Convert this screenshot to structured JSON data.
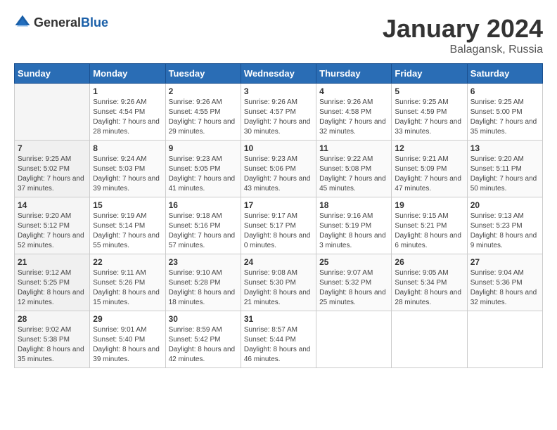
{
  "header": {
    "logo_general": "General",
    "logo_blue": "Blue",
    "month_title": "January 2024",
    "location": "Balagansk, Russia"
  },
  "weekdays": [
    "Sunday",
    "Monday",
    "Tuesday",
    "Wednesday",
    "Thursday",
    "Friday",
    "Saturday"
  ],
  "weeks": [
    [
      {
        "day": "",
        "sunrise": "",
        "sunset": "",
        "daylight": ""
      },
      {
        "day": "1",
        "sunrise": "Sunrise: 9:26 AM",
        "sunset": "Sunset: 4:54 PM",
        "daylight": "Daylight: 7 hours and 28 minutes."
      },
      {
        "day": "2",
        "sunrise": "Sunrise: 9:26 AM",
        "sunset": "Sunset: 4:55 PM",
        "daylight": "Daylight: 7 hours and 29 minutes."
      },
      {
        "day": "3",
        "sunrise": "Sunrise: 9:26 AM",
        "sunset": "Sunset: 4:57 PM",
        "daylight": "Daylight: 7 hours and 30 minutes."
      },
      {
        "day": "4",
        "sunrise": "Sunrise: 9:26 AM",
        "sunset": "Sunset: 4:58 PM",
        "daylight": "Daylight: 7 hours and 32 minutes."
      },
      {
        "day": "5",
        "sunrise": "Sunrise: 9:25 AM",
        "sunset": "Sunset: 4:59 PM",
        "daylight": "Daylight: 7 hours and 33 minutes."
      },
      {
        "day": "6",
        "sunrise": "Sunrise: 9:25 AM",
        "sunset": "Sunset: 5:00 PM",
        "daylight": "Daylight: 7 hours and 35 minutes."
      }
    ],
    [
      {
        "day": "7",
        "sunrise": "Sunrise: 9:25 AM",
        "sunset": "Sunset: 5:02 PM",
        "daylight": "Daylight: 7 hours and 37 minutes."
      },
      {
        "day": "8",
        "sunrise": "Sunrise: 9:24 AM",
        "sunset": "Sunset: 5:03 PM",
        "daylight": "Daylight: 7 hours and 39 minutes."
      },
      {
        "day": "9",
        "sunrise": "Sunrise: 9:23 AM",
        "sunset": "Sunset: 5:05 PM",
        "daylight": "Daylight: 7 hours and 41 minutes."
      },
      {
        "day": "10",
        "sunrise": "Sunrise: 9:23 AM",
        "sunset": "Sunset: 5:06 PM",
        "daylight": "Daylight: 7 hours and 43 minutes."
      },
      {
        "day": "11",
        "sunrise": "Sunrise: 9:22 AM",
        "sunset": "Sunset: 5:08 PM",
        "daylight": "Daylight: 7 hours and 45 minutes."
      },
      {
        "day": "12",
        "sunrise": "Sunrise: 9:21 AM",
        "sunset": "Sunset: 5:09 PM",
        "daylight": "Daylight: 7 hours and 47 minutes."
      },
      {
        "day": "13",
        "sunrise": "Sunrise: 9:20 AM",
        "sunset": "Sunset: 5:11 PM",
        "daylight": "Daylight: 7 hours and 50 minutes."
      }
    ],
    [
      {
        "day": "14",
        "sunrise": "Sunrise: 9:20 AM",
        "sunset": "Sunset: 5:12 PM",
        "daylight": "Daylight: 7 hours and 52 minutes."
      },
      {
        "day": "15",
        "sunrise": "Sunrise: 9:19 AM",
        "sunset": "Sunset: 5:14 PM",
        "daylight": "Daylight: 7 hours and 55 minutes."
      },
      {
        "day": "16",
        "sunrise": "Sunrise: 9:18 AM",
        "sunset": "Sunset: 5:16 PM",
        "daylight": "Daylight: 7 hours and 57 minutes."
      },
      {
        "day": "17",
        "sunrise": "Sunrise: 9:17 AM",
        "sunset": "Sunset: 5:17 PM",
        "daylight": "Daylight: 8 hours and 0 minutes."
      },
      {
        "day": "18",
        "sunrise": "Sunrise: 9:16 AM",
        "sunset": "Sunset: 5:19 PM",
        "daylight": "Daylight: 8 hours and 3 minutes."
      },
      {
        "day": "19",
        "sunrise": "Sunrise: 9:15 AM",
        "sunset": "Sunset: 5:21 PM",
        "daylight": "Daylight: 8 hours and 6 minutes."
      },
      {
        "day": "20",
        "sunrise": "Sunrise: 9:13 AM",
        "sunset": "Sunset: 5:23 PM",
        "daylight": "Daylight: 8 hours and 9 minutes."
      }
    ],
    [
      {
        "day": "21",
        "sunrise": "Sunrise: 9:12 AM",
        "sunset": "Sunset: 5:25 PM",
        "daylight": "Daylight: 8 hours and 12 minutes."
      },
      {
        "day": "22",
        "sunrise": "Sunrise: 9:11 AM",
        "sunset": "Sunset: 5:26 PM",
        "daylight": "Daylight: 8 hours and 15 minutes."
      },
      {
        "day": "23",
        "sunrise": "Sunrise: 9:10 AM",
        "sunset": "Sunset: 5:28 PM",
        "daylight": "Daylight: 8 hours and 18 minutes."
      },
      {
        "day": "24",
        "sunrise": "Sunrise: 9:08 AM",
        "sunset": "Sunset: 5:30 PM",
        "daylight": "Daylight: 8 hours and 21 minutes."
      },
      {
        "day": "25",
        "sunrise": "Sunrise: 9:07 AM",
        "sunset": "Sunset: 5:32 PM",
        "daylight": "Daylight: 8 hours and 25 minutes."
      },
      {
        "day": "26",
        "sunrise": "Sunrise: 9:05 AM",
        "sunset": "Sunset: 5:34 PM",
        "daylight": "Daylight: 8 hours and 28 minutes."
      },
      {
        "day": "27",
        "sunrise": "Sunrise: 9:04 AM",
        "sunset": "Sunset: 5:36 PM",
        "daylight": "Daylight: 8 hours and 32 minutes."
      }
    ],
    [
      {
        "day": "28",
        "sunrise": "Sunrise: 9:02 AM",
        "sunset": "Sunset: 5:38 PM",
        "daylight": "Daylight: 8 hours and 35 minutes."
      },
      {
        "day": "29",
        "sunrise": "Sunrise: 9:01 AM",
        "sunset": "Sunset: 5:40 PM",
        "daylight": "Daylight: 8 hours and 39 minutes."
      },
      {
        "day": "30",
        "sunrise": "Sunrise: 8:59 AM",
        "sunset": "Sunset: 5:42 PM",
        "daylight": "Daylight: 8 hours and 42 minutes."
      },
      {
        "day": "31",
        "sunrise": "Sunrise: 8:57 AM",
        "sunset": "Sunset: 5:44 PM",
        "daylight": "Daylight: 8 hours and 46 minutes."
      },
      {
        "day": "",
        "sunrise": "",
        "sunset": "",
        "daylight": ""
      },
      {
        "day": "",
        "sunrise": "",
        "sunset": "",
        "daylight": ""
      },
      {
        "day": "",
        "sunrise": "",
        "sunset": "",
        "daylight": ""
      }
    ]
  ]
}
